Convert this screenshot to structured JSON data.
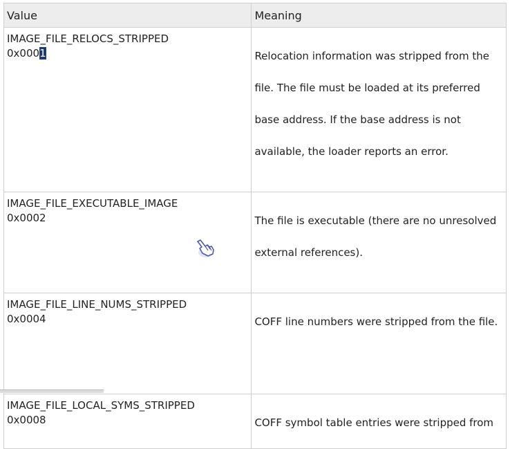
{
  "table": {
    "headers": {
      "value": "Value",
      "meaning": "Meaning"
    },
    "rows": [
      {
        "name": "IMAGE_FILE_RELOCS_STRIPPED",
        "hex_prefix": "0x000",
        "hex_selected": "1",
        "meaning": "Relocation information was stripped from the file. The file must be loaded at its preferred base address. If the base address is not available, the loader reports an error."
      },
      {
        "name": "IMAGE_FILE_EXECUTABLE_IMAGE",
        "hex": "0x0002",
        "meaning": "The file is executable (there are no unresolved external references)."
      },
      {
        "name": "IMAGE_FILE_LINE_NUMS_STRIPPED",
        "hex": "0x0004",
        "meaning": "COFF line numbers were stripped from the file."
      },
      {
        "name": "IMAGE_FILE_LOCAL_SYMS_STRIPPED",
        "hex": "0x0008",
        "meaning": "COFF symbol table entries were stripped from"
      }
    ]
  },
  "cursor": {
    "icon": "hand-pointer-icon"
  }
}
